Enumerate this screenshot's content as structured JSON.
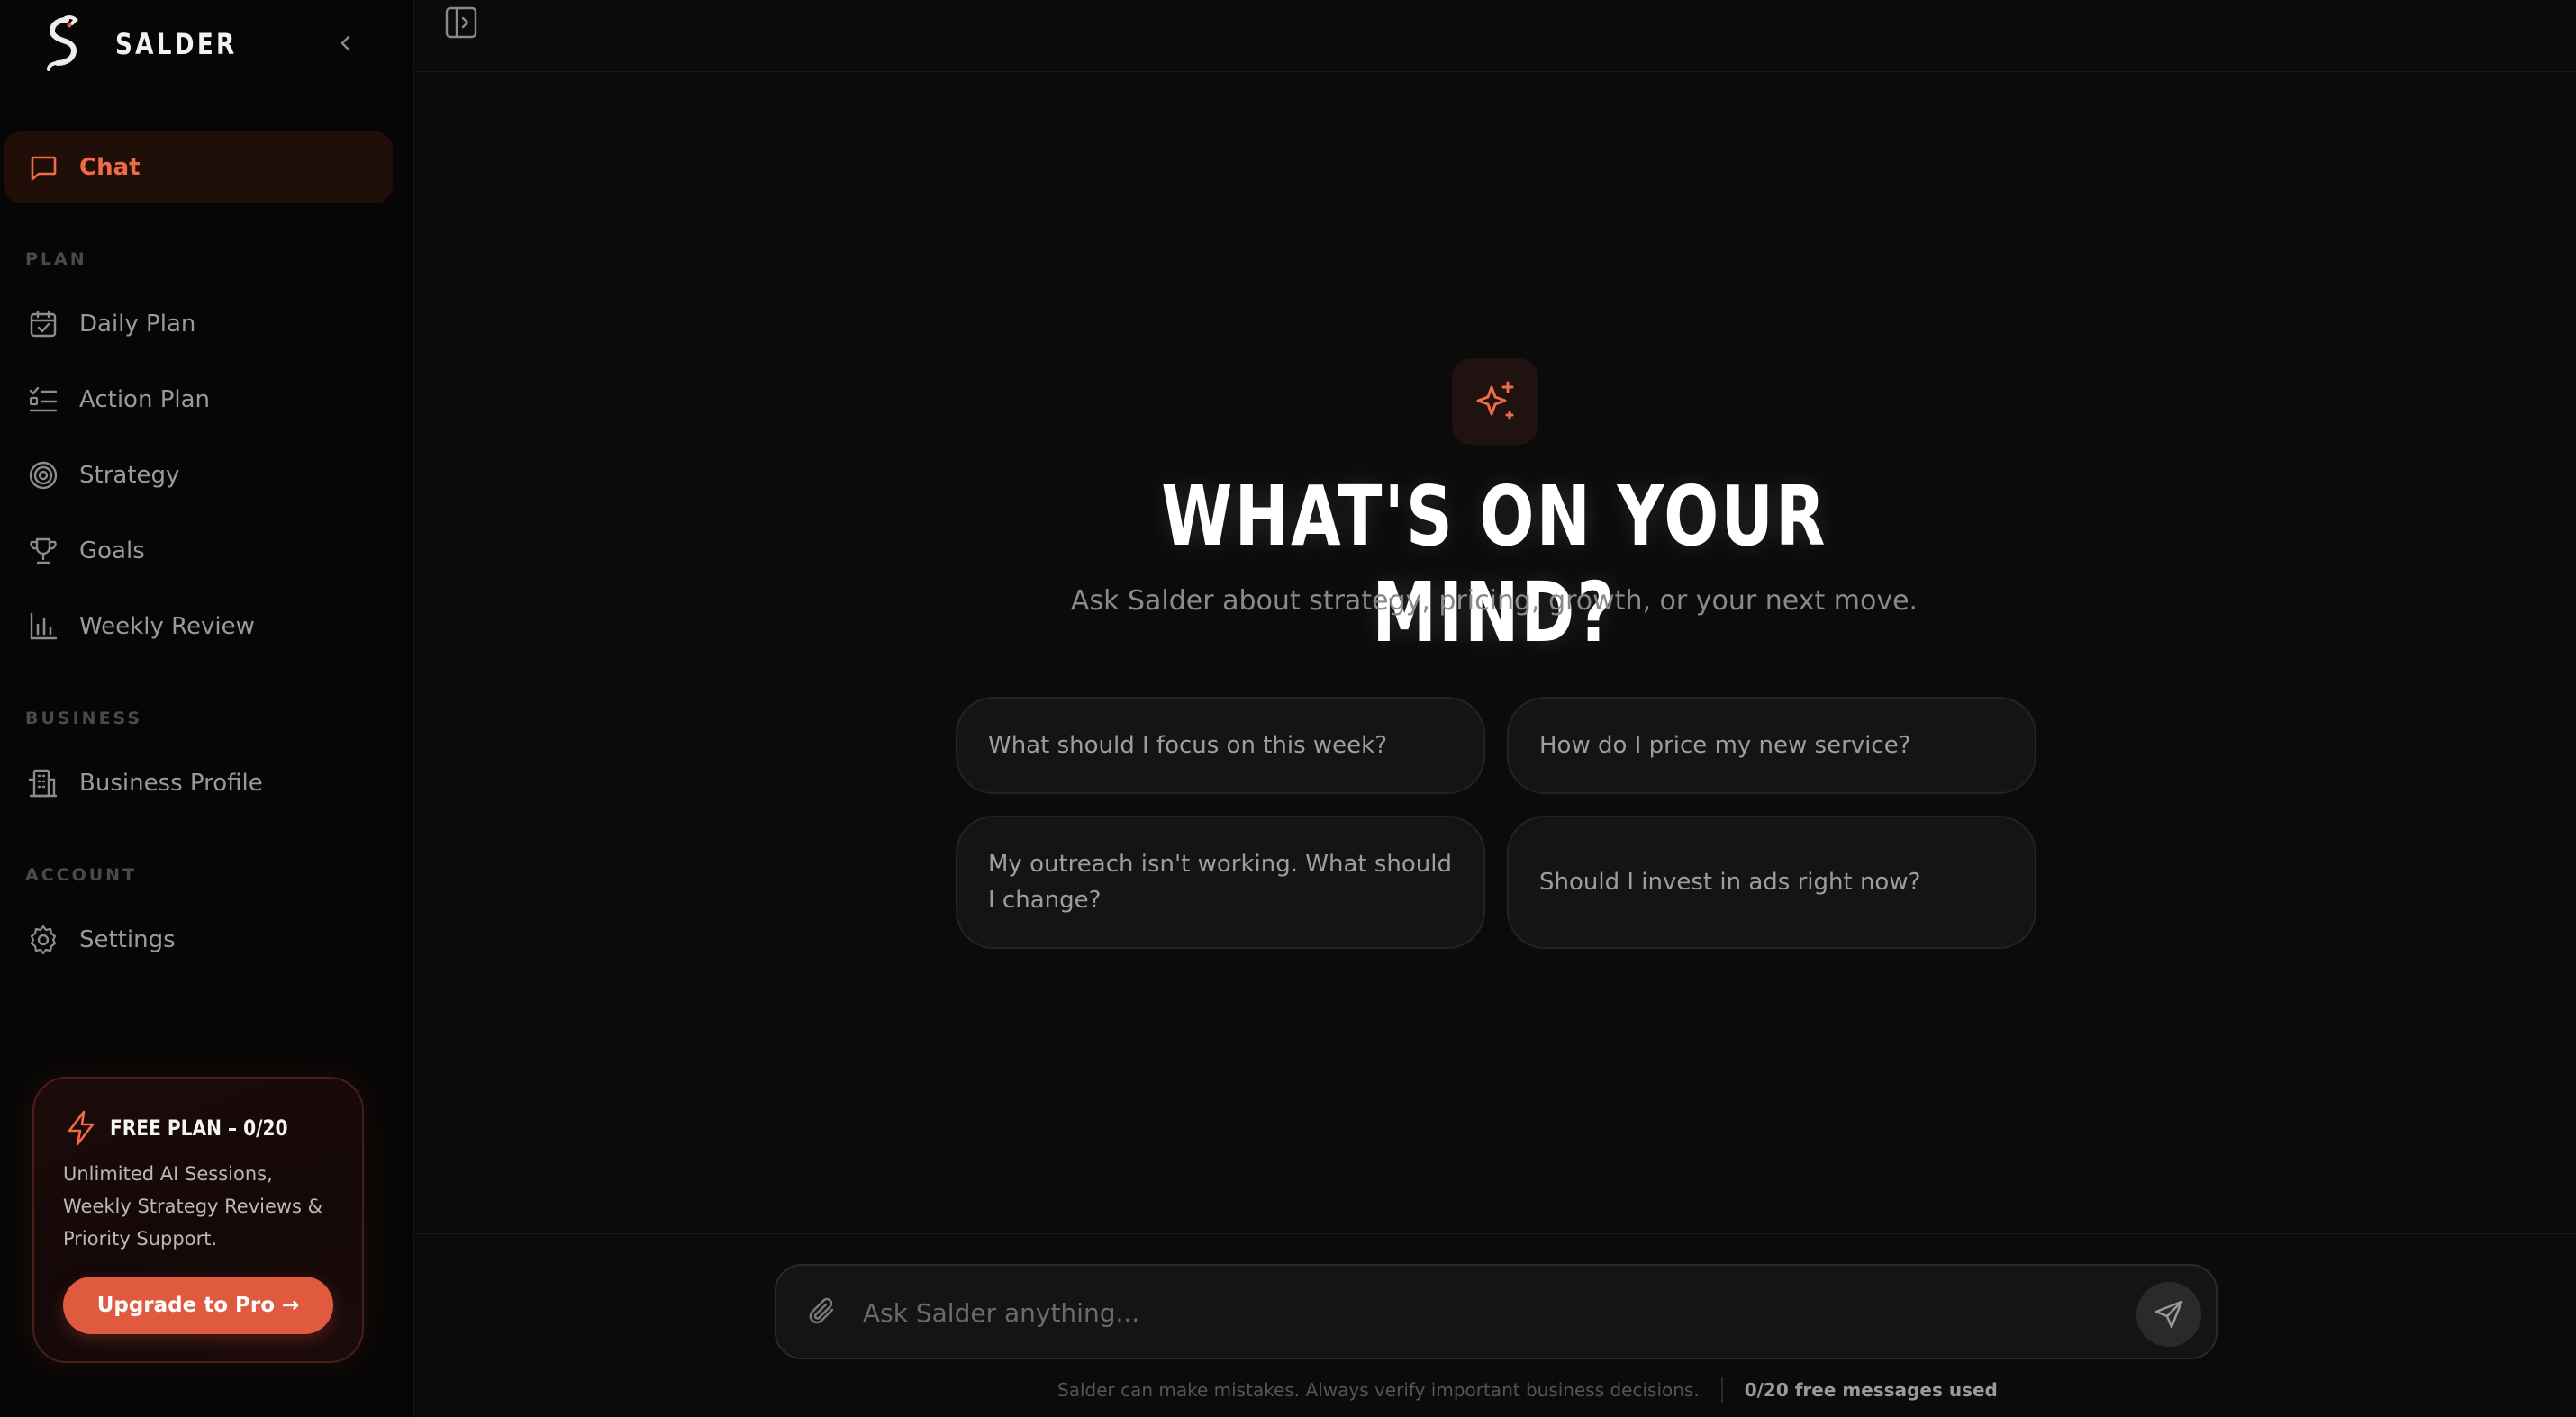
{
  "brand": {
    "name": "SALDER"
  },
  "nav": {
    "chat": "Chat",
    "sections": {
      "plan": "PLAN",
      "business": "BUSINESS",
      "account": "ACCOUNT"
    },
    "daily_plan": "Daily Plan",
    "action_plan": "Action Plan",
    "strategy": "Strategy",
    "goals": "Goals",
    "weekly_review": "Weekly Review",
    "business_profile": "Business Profile",
    "settings": "Settings"
  },
  "plan_card": {
    "title": "FREE PLAN – 0/20",
    "description": "Unlimited AI Sessions, Weekly Strategy Reviews & Priority Support.",
    "upgrade_label": "Upgrade to Pro →"
  },
  "hero": {
    "title": "WHAT'S ON YOUR MIND?",
    "subtitle": "Ask Salder about strategy, pricing, growth, or your next move."
  },
  "suggestions": [
    "What should I focus on this week?",
    "How do I price my new service?",
    "My outreach isn't working. What should I change?",
    "Should I invest in ads right now?"
  ],
  "composer": {
    "placeholder": "Ask Salder anything..."
  },
  "footer": {
    "disclaimer": "Salder can make mistakes. Always verify important business decisions.",
    "usage": "0/20 free messages used"
  },
  "colors": {
    "accent": "#ef6a47",
    "button": "#df5a3e",
    "background": "#0b0b0b"
  }
}
